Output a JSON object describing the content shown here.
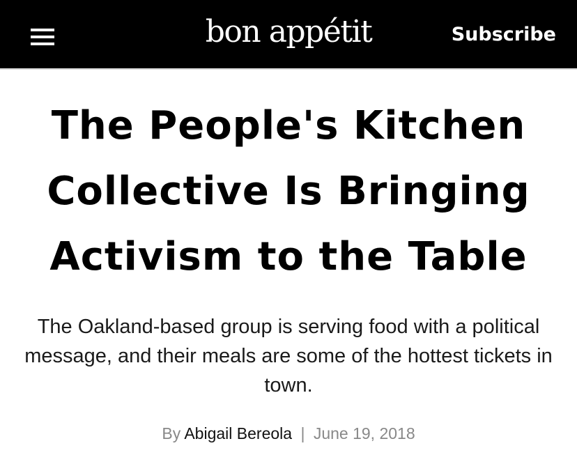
{
  "header": {
    "logo": "bon appétit",
    "subscribe_label": "Subscribe",
    "background": "#000000",
    "text_color": "#ffffff",
    "menu_icon": "hamburger-menu-icon"
  },
  "article": {
    "headline": "The People's Kitchen Collective Is Bringing Activism to the Table",
    "dek": "The Oakland-based group is serving food with a political message, and their meals are some of the hottest tickets in town.",
    "byline": {
      "prefix": "By",
      "author": "Abigail Bereola",
      "separator": "|",
      "date": "June 19, 2018"
    }
  }
}
